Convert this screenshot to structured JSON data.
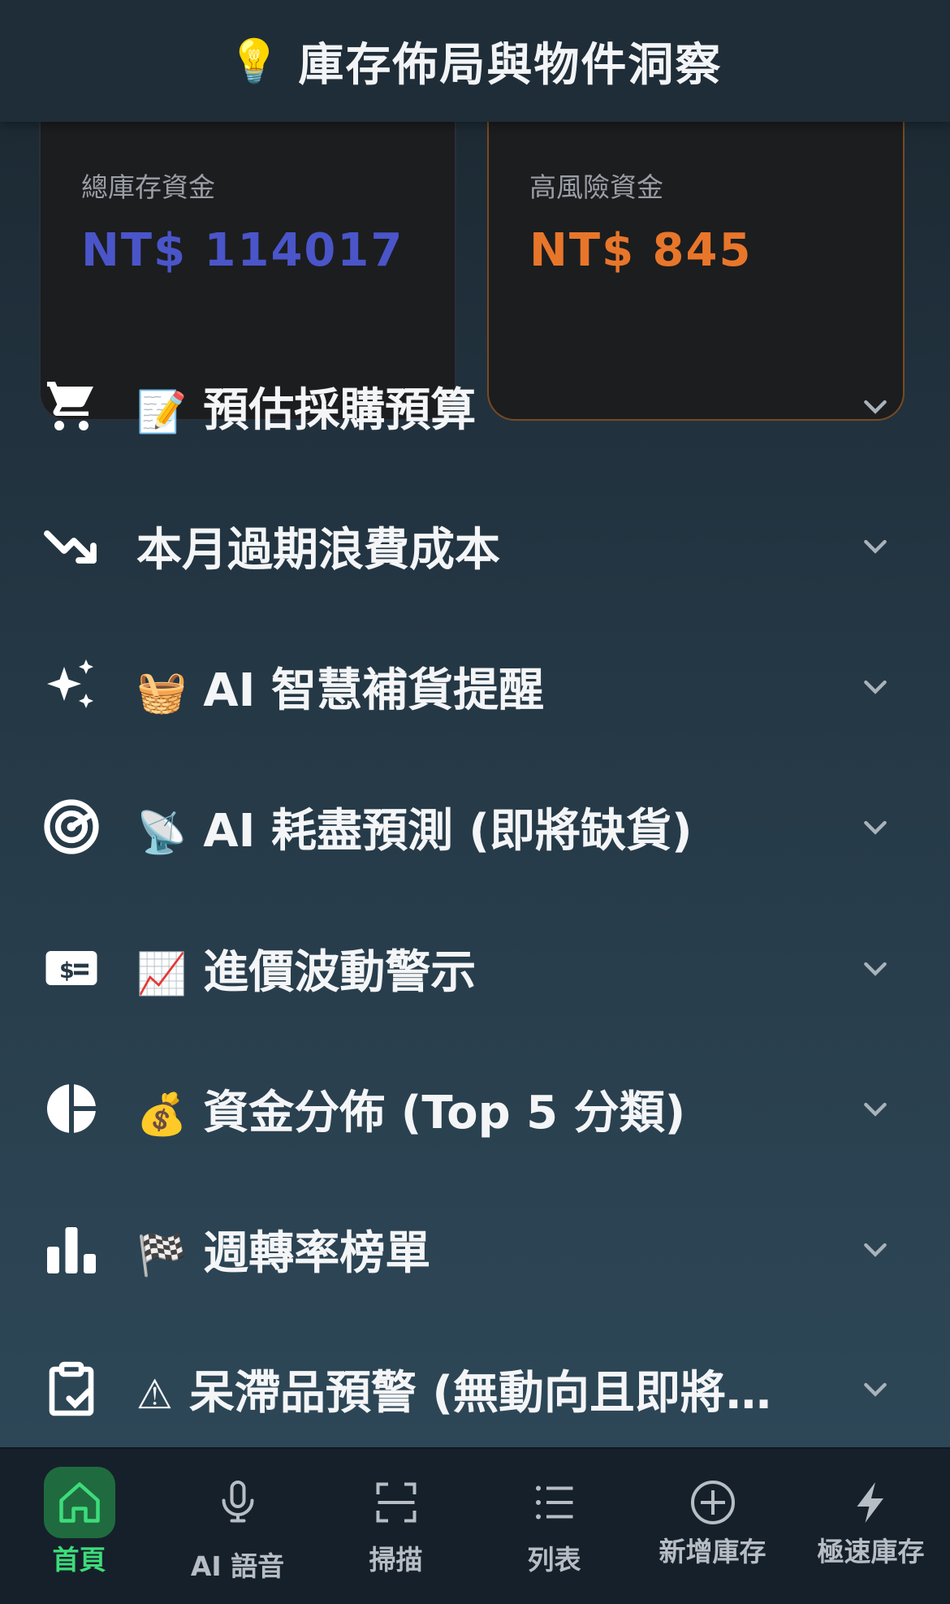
{
  "header": {
    "icon": "lightbulb-icon",
    "title": "庫存佈局與物件洞察"
  },
  "cards": {
    "total": {
      "label": "總庫存資金",
      "value": "NT$ 114017",
      "accent": "#4a55c9"
    },
    "risk": {
      "label": "高風險資金",
      "value": "NT$ 845",
      "accent": "#e8762a"
    }
  },
  "sections": [
    {
      "icon": "cart-icon",
      "emoji": "📝",
      "label": "預估採購預算"
    },
    {
      "icon": "trending-down-icon",
      "emoji": "",
      "label": "本月過期浪費成本"
    },
    {
      "icon": "sparkles-icon",
      "emoji": "🧺",
      "label": "AI 智慧補貨提醒"
    },
    {
      "icon": "target-icon",
      "emoji": "📡",
      "label": "AI 耗盡預測 (即將缺貨)"
    },
    {
      "icon": "cash-icon",
      "emoji": "📈",
      "label": "進價波動警示"
    },
    {
      "icon": "pie-chart-icon",
      "emoji": "💰",
      "label": "資金分佈 (Top 5 分類)"
    },
    {
      "icon": "bar-chart-icon",
      "emoji": "🏁",
      "label": "週轉率榜單"
    },
    {
      "icon": "clipboard-check-icon",
      "emoji": "⚠",
      "label": "呆滯品預警 (無動向且即將…"
    }
  ],
  "tabs": [
    {
      "icon": "home-icon",
      "label": "首頁",
      "active": true
    },
    {
      "icon": "microphone-icon",
      "label": "AI 語音"
    },
    {
      "icon": "scan-icon",
      "label": "掃描"
    },
    {
      "icon": "list-icon",
      "label": "列表"
    },
    {
      "icon": "plus-circle-icon",
      "label": "新增庫存"
    },
    {
      "icon": "lightning-icon",
      "label": "極速庫存"
    }
  ]
}
